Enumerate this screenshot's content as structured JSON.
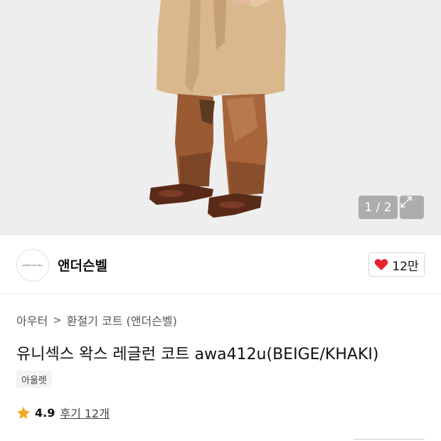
{
  "gallery": {
    "counter": "1 / 2"
  },
  "brand": {
    "name": "앤더슨벨",
    "logo_text": "ANDERSSON BELL"
  },
  "wishlist": {
    "count": "12만"
  },
  "breadcrumb": {
    "items": [
      "아우터",
      "환절기 코트 (앤더슨벨)"
    ]
  },
  "product": {
    "title": "유니섹스 왁스 레글런 코트 awa412u(BEIGE/KHAKI)",
    "tag": "아울렛",
    "rating": "4.9",
    "reviews": "후기 12개"
  },
  "colors": {
    "heart": "#e8222e",
    "star": "#f5a623",
    "background": "#eeeeee"
  }
}
